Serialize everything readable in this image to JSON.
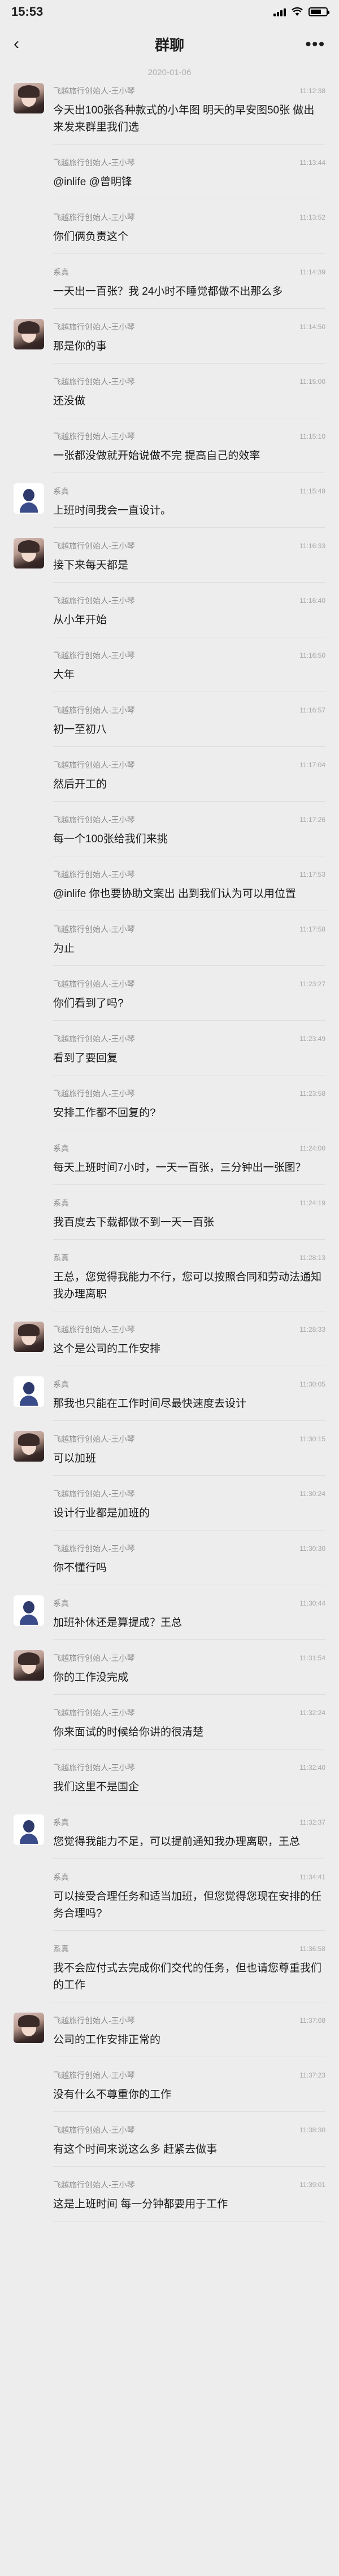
{
  "status_bar": {
    "time": "15:53"
  },
  "nav": {
    "title": "群聊",
    "back_icon": "‹",
    "more_icon": "•••"
  },
  "date_divider": "2020-01-06",
  "messages": [
    {
      "avatar": "wang",
      "sender": "飞越旅行创始人-王小琴",
      "time": "11:12:38",
      "text": "今天出100张各种款式的小年图 明天的早安图50张 做出来发来群里我们选"
    },
    {
      "avatar": "none",
      "sender": "飞越旅行创始人-王小琴",
      "time": "11:13:44",
      "text": "@inlife @曾明锋"
    },
    {
      "avatar": "none",
      "sender": "飞越旅行创始人-王小琴",
      "time": "11:13:52",
      "text": "你们俩负责这个"
    },
    {
      "avatar": "none",
      "sender": "系真",
      "time": "11:14:39",
      "text": "一天出一百张？我 24小时不睡觉都做不出那么多"
    },
    {
      "avatar": "wang",
      "sender": "飞越旅行创始人-王小琴",
      "time": "11:14:50",
      "text": "那是你的事"
    },
    {
      "avatar": "none",
      "sender": "飞越旅行创始人-王小琴",
      "time": "11:15:00",
      "text": "还没做"
    },
    {
      "avatar": "none",
      "sender": "飞越旅行创始人-王小琴",
      "time": "11:15:10",
      "text": "一张都没做就开始说做不完 提高自己的效率"
    },
    {
      "avatar": "sys",
      "sender": "系真",
      "time": "11:15:48",
      "text": "上班时间我会一直设计。"
    },
    {
      "avatar": "wang",
      "sender": "飞越旅行创始人-王小琴",
      "time": "11:16:33",
      "text": "接下来每天都是"
    },
    {
      "avatar": "none",
      "sender": "飞越旅行创始人-王小琴",
      "time": "11:16:40",
      "text": "从小年开始"
    },
    {
      "avatar": "none",
      "sender": "飞越旅行创始人-王小琴",
      "time": "11:16:50",
      "text": "大年"
    },
    {
      "avatar": "none",
      "sender": "飞越旅行创始人-王小琴",
      "time": "11:16:57",
      "text": "初一至初八"
    },
    {
      "avatar": "none",
      "sender": "飞越旅行创始人-王小琴",
      "time": "11:17:04",
      "text": "然后开工的"
    },
    {
      "avatar": "none",
      "sender": "飞越旅行创始人-王小琴",
      "time": "11:17:26",
      "text": "每一个100张给我们来挑"
    },
    {
      "avatar": "none",
      "sender": "飞越旅行创始人-王小琴",
      "time": "11:17:53",
      "text": "@inlife 你也要协助文案出 出到我们认为可以用位置"
    },
    {
      "avatar": "none",
      "sender": "飞越旅行创始人-王小琴",
      "time": "11:17:58",
      "text": "为止"
    },
    {
      "avatar": "none",
      "sender": "飞越旅行创始人-王小琴",
      "time": "11:23:27",
      "text": "你们看到了吗?"
    },
    {
      "avatar": "none",
      "sender": "飞越旅行创始人-王小琴",
      "time": "11:23:49",
      "text": "看到了要回复"
    },
    {
      "avatar": "none",
      "sender": "飞越旅行创始人-王小琴",
      "time": "11:23:58",
      "text": "安排工作都不回复的?"
    },
    {
      "avatar": "none",
      "sender": "系真",
      "time": "11:24:00",
      "text": "每天上班时间7小时，一天一百张，三分钟出一张图？"
    },
    {
      "avatar": "none",
      "sender": "系真",
      "time": "11:24:19",
      "text": "我百度去下载都做不到一天一百张"
    },
    {
      "avatar": "none",
      "sender": "系真",
      "time": "11:28:13",
      "text": "王总，您觉得我能力不行，您可以按照合同和劳动法通知我办理离职"
    },
    {
      "avatar": "wang",
      "sender": "飞越旅行创始人-王小琴",
      "time": "11:28:33",
      "text": "这个是公司的工作安排"
    },
    {
      "avatar": "sys",
      "sender": "系真",
      "time": "11:30:05",
      "text": "那我也只能在工作时间尽最快速度去设计"
    },
    {
      "avatar": "wang",
      "sender": "飞越旅行创始人-王小琴",
      "time": "11:30:15",
      "text": "可以加班"
    },
    {
      "avatar": "none",
      "sender": "飞越旅行创始人-王小琴",
      "time": "11:30:24",
      "text": "设计行业都是加班的"
    },
    {
      "avatar": "none",
      "sender": "飞越旅行创始人-王小琴",
      "time": "11:30:30",
      "text": "你不懂行吗"
    },
    {
      "avatar": "sys",
      "sender": "系真",
      "time": "11:30:44",
      "text": "加班补休还是算提成？王总"
    },
    {
      "avatar": "wang",
      "sender": "飞越旅行创始人-王小琴",
      "time": "11:31:54",
      "text": "你的工作没完成"
    },
    {
      "avatar": "none",
      "sender": "飞越旅行创始人-王小琴",
      "time": "11:32:24",
      "text": "你来面试的时候给你讲的很清楚"
    },
    {
      "avatar": "none",
      "sender": "飞越旅行创始人-王小琴",
      "time": "11:32:40",
      "text": "我们这里不是国企"
    },
    {
      "avatar": "sys",
      "sender": "系真",
      "time": "11:32:37",
      "text": "您觉得我能力不足，可以提前通知我办理离职，王总"
    },
    {
      "avatar": "none",
      "sender": "系真",
      "time": "11:34:41",
      "text": "可以接受合理任务和适当加班，但您觉得您现在安排的任务合理吗?"
    },
    {
      "avatar": "none",
      "sender": "系真",
      "time": "11:36:58",
      "text": "我不会应付式去完成你们交代的任务，但也请您尊重我们的工作"
    },
    {
      "avatar": "wang",
      "sender": "飞越旅行创始人-王小琴",
      "time": "11:37:08",
      "text": "公司的工作安排正常的"
    },
    {
      "avatar": "none",
      "sender": "飞越旅行创始人-王小琴",
      "time": "11:37:23",
      "text": "没有什么不尊重你的工作"
    },
    {
      "avatar": "none",
      "sender": "飞越旅行创始人-王小琴",
      "time": "11:38:30",
      "text": "有这个时间来说这么多 赶紧去做事"
    },
    {
      "avatar": "none",
      "sender": "飞越旅行创始人-王小琴",
      "time": "11:39:01",
      "text": "这是上班时间 每一分钟都要用于工作"
    }
  ]
}
